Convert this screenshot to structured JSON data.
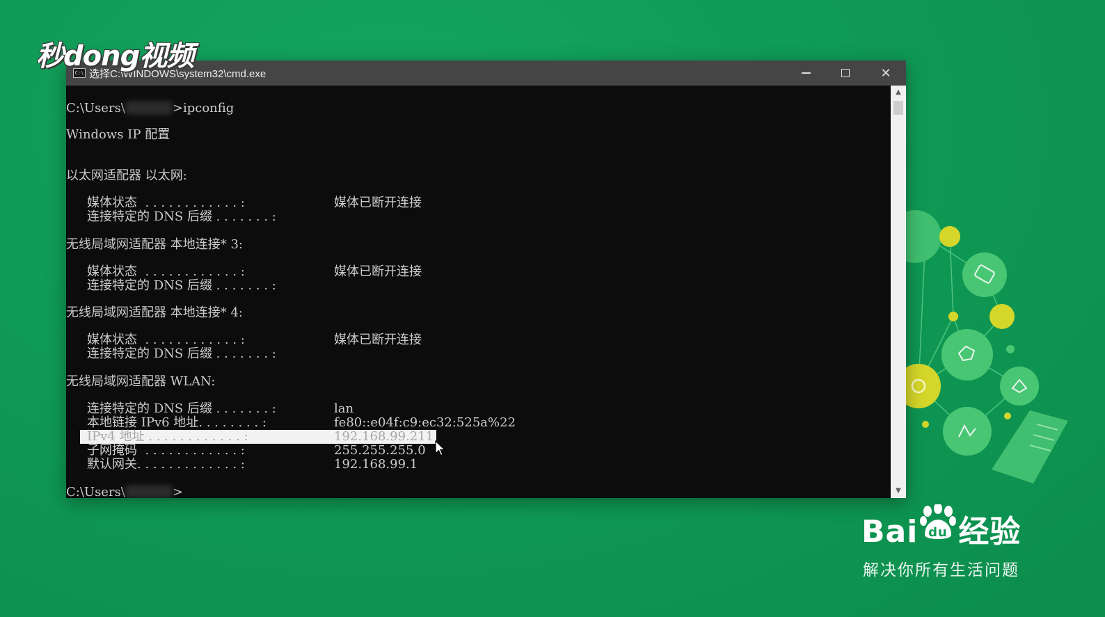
{
  "watermark": {
    "brand": "秒dong视频"
  },
  "window": {
    "title": "选择C:\\WINDOWS\\system32\\cmd.exe",
    "minimize_label": "–",
    "close_label": "✕"
  },
  "console": {
    "prompt_prefix": "C:\\Users\\",
    "command": ">ipconfig",
    "header": "Windows IP 配置",
    "sections": [
      {
        "title": "以太网适配器 以太网:",
        "entries": [
          {
            "label": "媒体状态  . . . . . . . . . . . . :",
            "value": "媒体已断开连接"
          },
          {
            "label": "连接特定的 DNS 后缀 . . . . . . . :",
            "value": ""
          }
        ]
      },
      {
        "title": "无线局域网适配器 本地连接* 3:",
        "entries": [
          {
            "label": "媒体状态  . . . . . . . . . . . . :",
            "value": "媒体已断开连接"
          },
          {
            "label": "连接特定的 DNS 后缀 . . . . . . . :",
            "value": ""
          }
        ]
      },
      {
        "title": "无线局域网适配器 本地连接* 4:",
        "entries": [
          {
            "label": "媒体状态  . . . . . . . . . . . . :",
            "value": "媒体已断开连接"
          },
          {
            "label": "连接特定的 DNS 后缀 . . . . . . . :",
            "value": ""
          }
        ]
      },
      {
        "title": "无线局域网适配器 WLAN:",
        "entries": [
          {
            "label": "连接特定的 DNS 后缀 . . . . . . . :",
            "value": "lan"
          },
          {
            "label": "本地链接 IPv6 地址. . . . . . . . :",
            "value": "fe80::e04f:c9:ec32:525a%22"
          },
          {
            "label": "IPv4 地址 . . . . . . . . . . . . :",
            "value": "192.168.99.211",
            "highlighted": true
          },
          {
            "label": "子网掩码  . . . . . . . . . . . . :",
            "value": "255.255.255.0"
          },
          {
            "label": "默认网关. . . . . . . . . . . . . :",
            "value": "192.168.99.1"
          }
        ]
      }
    ],
    "final_prompt_suffix": ">"
  },
  "baidu": {
    "logo_text_left": "Bai",
    "logo_text_right": "经验",
    "slogan": "解决你所有生活问题"
  },
  "colors": {
    "background": "#0f9a55",
    "console_bg": "#0c0c0c",
    "console_text": "#cccccc",
    "titlebar": "#454545"
  }
}
